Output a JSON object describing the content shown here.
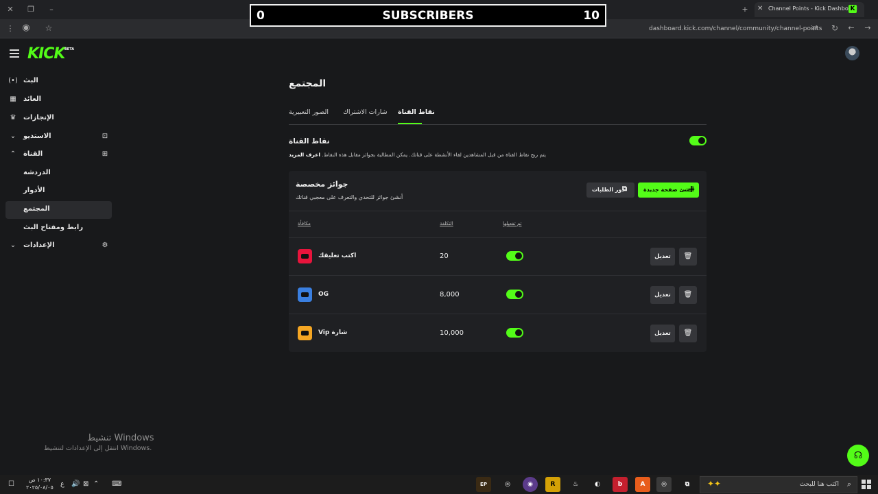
{
  "browser": {
    "tab_title": "Channel Points - Kick Dashboard",
    "favicon_letter": "K",
    "url": "dashboard.kick.com/channel/community/channel-points"
  },
  "overlay": {
    "left_value": "0",
    "title": "SUBSCRIBERS",
    "right_value": "10"
  },
  "header": {
    "logo": "KICK",
    "logo_badge": "BETA"
  },
  "sidebar": {
    "items": [
      {
        "label": "البث",
        "icon": "broadcast-icon"
      },
      {
        "label": "العائد",
        "icon": "revenue-icon"
      },
      {
        "label": "الإنجازات",
        "icon": "trophy-icon"
      },
      {
        "label": "الاستديو",
        "icon": "studio-icon"
      },
      {
        "label": "القناة",
        "icon": "channel-icon"
      },
      {
        "label": "الدردشة"
      },
      {
        "label": "الأدوار"
      },
      {
        "label": "المجتمع"
      },
      {
        "label": "رابط ومفتاح البث"
      },
      {
        "label": "الإعدادات",
        "icon": "gear-icon"
      }
    ]
  },
  "main": {
    "title": "المجتمع",
    "tabs": [
      {
        "label": "نقاط القناة"
      },
      {
        "label": "شارات الاشتراك"
      },
      {
        "label": "الصور التعبيرية"
      }
    ],
    "channel_points": {
      "title": "نقاط القناة",
      "learn_more": "اعرف المزيد",
      "description": "يتم ربح نقاط القناة من قبل المشاهدين لقاء الأنشطة على قناتك. يمكن المطالبة بجوائز مقابل هذه النقاط.",
      "enabled": true
    },
    "rewards": {
      "title": "جوائز مخصصة",
      "description": "أنشئ جوائز للتحدي والتعرف على معجبي قناتك",
      "create_button": "أنشئ صفحة جديدة",
      "queue_button": "دور الطلبات",
      "columns": {
        "reward": "مكافأة",
        "cost": "التكلفة",
        "enabled": "تم تفعيلها"
      },
      "rows": [
        {
          "name": "اكتب تعليقك",
          "cost": "20",
          "enabled": true,
          "color": "#e8143c",
          "edit": "تعديل"
        },
        {
          "name": "OG",
          "cost": "8,000",
          "enabled": true,
          "color": "#3a7fe0",
          "edit": "تعديل"
        },
        {
          "name": "Vip شارة",
          "cost": "10,000",
          "enabled": true,
          "color": "#f5a623",
          "edit": "تعديل"
        }
      ]
    }
  },
  "windows": {
    "watermark_title": "تنشيط Windows",
    "watermark_sub": "انتقل إلى الإعدادات لتنشيط Windows.",
    "search_placeholder": "اكتب هنا للبحث",
    "clock_time": "١٠:٣٧ ص",
    "clock_date": "٢٠٢٥/٠٨/٠٥",
    "lang": "ع"
  },
  "colors": {
    "accent": "#53fc18",
    "background": "#18191b",
    "panel": "#1f2023"
  }
}
